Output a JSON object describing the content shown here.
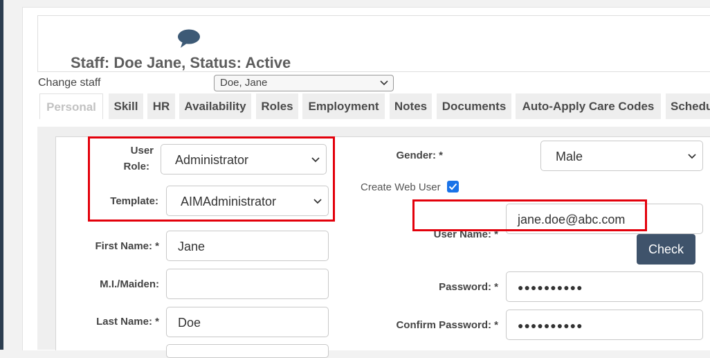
{
  "header": {
    "title": "Staff: Doe Jane, Status: Active"
  },
  "change_staff": {
    "label": "Change staff",
    "selected": "Doe, Jane"
  },
  "tabs": [
    {
      "label": "Personal",
      "active": true
    },
    {
      "label": "Skill"
    },
    {
      "label": "HR"
    },
    {
      "label": "Availability"
    },
    {
      "label": "Roles"
    },
    {
      "label": "Employment"
    },
    {
      "label": "Notes"
    },
    {
      "label": "Documents"
    },
    {
      "label": "Auto-Apply Care Codes"
    },
    {
      "label": "Schedu"
    }
  ],
  "form": {
    "user_role": {
      "label_line1": "User",
      "label_line2": "Role:",
      "value": "Administrator"
    },
    "template": {
      "label": "Template:",
      "value": "AIMAdministrator"
    },
    "first_name": {
      "label": "First Name: *",
      "value": "Jane"
    },
    "mi_maiden": {
      "label": "M.I./Maiden:",
      "value": ""
    },
    "last_name": {
      "label": "Last Name: *",
      "value": "Doe"
    },
    "gender": {
      "label": "Gender: *",
      "value": "Male"
    },
    "create_web_user": {
      "label": "Create Web User",
      "checked": true
    },
    "user_name": {
      "label": "User Name: *",
      "value": "jane.doe@abc.com"
    },
    "check_button": "Check",
    "password": {
      "label": "Password: *",
      "value": "●●●●●●●●●●"
    },
    "confirm_password": {
      "label": "Confirm Password: *",
      "value": "●●●●●●●●●●"
    }
  },
  "colors": {
    "highlight": "#e3000b",
    "check_button": "#3f536b",
    "checkbox": "#1a73e8"
  }
}
